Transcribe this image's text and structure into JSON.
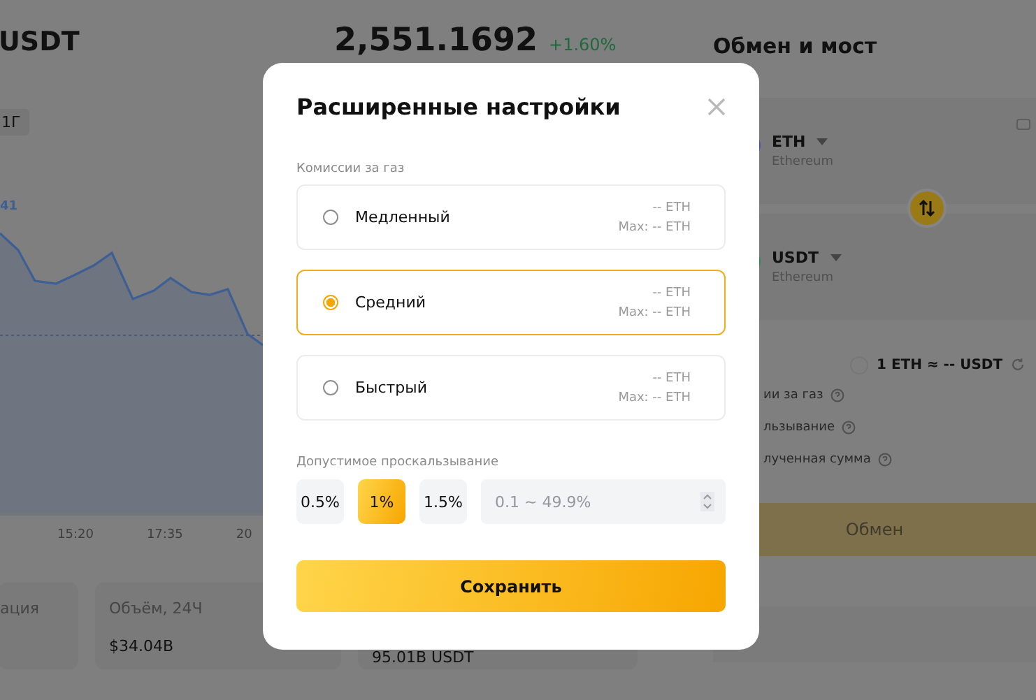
{
  "pair": {
    "title": "USDT",
    "price": "2,551.1692",
    "change": "+1.60%"
  },
  "range_chip": "1Г",
  "chart": {
    "peak_label": "41",
    "x_labels": [
      "15:20",
      "17:35",
      "20"
    ]
  },
  "stats": [
    {
      "label": "ация"
    },
    {
      "label": "Объём, 24Ч",
      "value": "$34.04B"
    },
    {
      "value": "95.01B USDT"
    }
  ],
  "swap": {
    "title": "Обмен и мост",
    "tokens": [
      {
        "symbol": "ETH",
        "network": "Ethereum",
        "kind": "eth"
      },
      {
        "symbol": "USDT",
        "network": "Ethereum",
        "kind": "usdt"
      }
    ],
    "rate": "1 ETH ≈ -- USDT",
    "details": [
      "ии за газ",
      "льзывание",
      "лученная сумма"
    ],
    "button": {
      "label": "Обмен",
      "disabled": true
    }
  },
  "dialog": {
    "title": "Расширенные настройки",
    "gas_label": "Комиссии за газ",
    "gas_options": [
      {
        "name": "Медленный",
        "fee": "-- ETH",
        "max": "Max: -- ETH",
        "selected": false
      },
      {
        "name": "Средний",
        "fee": "-- ETH",
        "max": "Max: -- ETH",
        "selected": true
      },
      {
        "name": "Быстрый",
        "fee": "-- ETH",
        "max": "Max: -- ETH",
        "selected": false
      }
    ],
    "slippage_label": "Допустимое проскальзывание",
    "slippage_options": [
      {
        "label": "0.5%",
        "selected": false
      },
      {
        "label": "1%",
        "selected": true
      },
      {
        "label": "1.5%",
        "selected": false
      }
    ],
    "slippage_input": {
      "placeholder": "0.1 ~ 49.9%"
    },
    "save": "Сохранить"
  }
}
